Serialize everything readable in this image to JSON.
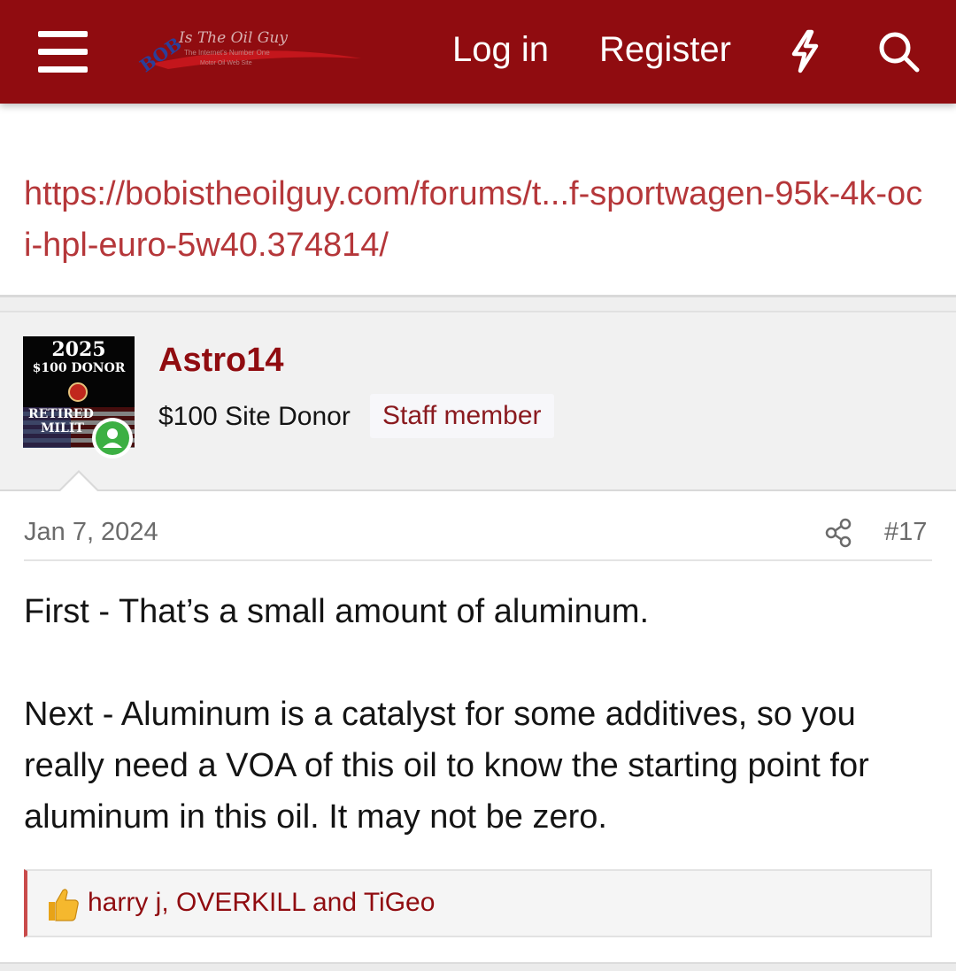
{
  "header": {
    "logo_text": "BOB Is The Oil Guy",
    "logo_tagline": "The Internet's Number One Motor Oil Web Site",
    "login_label": "Log in",
    "register_label": "Register",
    "colors": {
      "bar": "#900c10",
      "text": "#ffffff"
    }
  },
  "previous_post": {
    "link_text": "https://bobistheoilguy.com/forums/t...f-sportwagen-95k-4k-oci-hpl-euro-5w40.374814/"
  },
  "user": {
    "avatar_year": "2025",
    "avatar_donor": "$100 DONOR",
    "avatar_retired": "RETIRED",
    "avatar_military": "MILIT",
    "username": "Astro14",
    "user_title": "$100 Site Donor",
    "staff_badge": "Staff member",
    "online": true
  },
  "post": {
    "date": "Jan 7, 2024",
    "number": "#17",
    "paragraphs": [
      "First - That’s a small amount of aluminum.",
      "Next - Aluminum is a catalyst for some additives, so you really need a VOA of this oil to know the starting point for aluminum in this oil. It may not be zero."
    ]
  },
  "reactions": {
    "icon": "thumbs-up-icon",
    "text": "harry j, OVERKILL and TiGeo"
  }
}
